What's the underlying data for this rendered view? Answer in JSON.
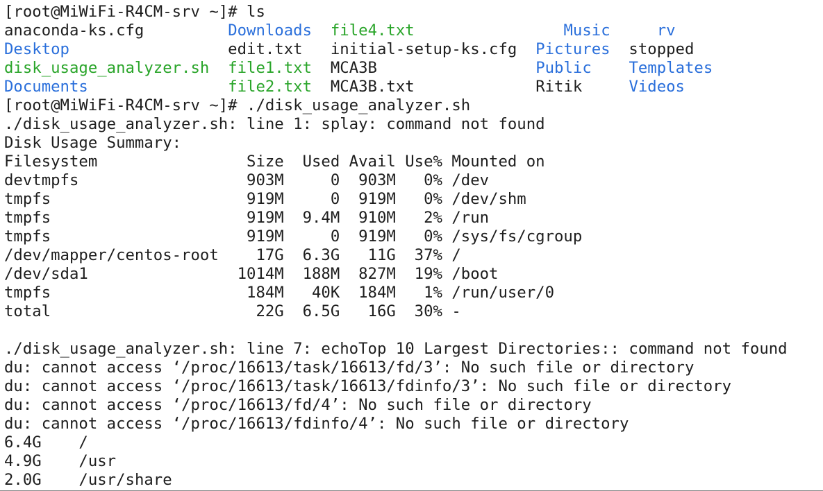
{
  "colors": {
    "directory": "#2a6fdb",
    "executable": "#2aa52a",
    "text": "#1e1e1e",
    "background": "#ffffff"
  },
  "lines": [
    [
      {
        "t": "[root@MiWiFi-R4CM-srv ~]# ls",
        "c": "plain"
      }
    ],
    [
      {
        "t": "anaconda-ks.cfg         ",
        "c": "plain"
      },
      {
        "t": "Downloads",
        "c": "dir"
      },
      {
        "t": "  ",
        "c": "plain"
      },
      {
        "t": "file4.txt",
        "c": "exe"
      },
      {
        "t": "                ",
        "c": "plain"
      },
      {
        "t": "Music",
        "c": "dir"
      },
      {
        "t": "     ",
        "c": "plain"
      },
      {
        "t": "rv",
        "c": "dir"
      }
    ],
    [
      {
        "t": "Desktop",
        "c": "dir"
      },
      {
        "t": "                 edit.txt   initial-setup-ks.cfg  ",
        "c": "plain"
      },
      {
        "t": "Pictures",
        "c": "dir"
      },
      {
        "t": "  stopped",
        "c": "plain"
      }
    ],
    [
      {
        "t": "disk_usage_analyzer.sh",
        "c": "exe"
      },
      {
        "t": "  ",
        "c": "plain"
      },
      {
        "t": "file1.txt",
        "c": "exe"
      },
      {
        "t": "  MCA3B                 ",
        "c": "plain"
      },
      {
        "t": "Public",
        "c": "dir"
      },
      {
        "t": "    ",
        "c": "plain"
      },
      {
        "t": "Templates",
        "c": "dir"
      }
    ],
    [
      {
        "t": "Documents",
        "c": "dir"
      },
      {
        "t": "               ",
        "c": "plain"
      },
      {
        "t": "file2.txt",
        "c": "exe"
      },
      {
        "t": "  MCA3B.txt             Ritik     ",
        "c": "plain"
      },
      {
        "t": "Videos",
        "c": "dir"
      }
    ],
    [
      {
        "t": "[root@MiWiFi-R4CM-srv ~]# ./disk_usage_analyzer.sh",
        "c": "plain"
      }
    ],
    [
      {
        "t": "./disk_usage_analyzer.sh: line 1: splay: command not found",
        "c": "plain"
      }
    ],
    [
      {
        "t": "Disk Usage Summary:",
        "c": "plain"
      }
    ],
    [
      {
        "t": "Filesystem                Size  Used Avail Use% Mounted on",
        "c": "plain"
      }
    ],
    [
      {
        "t": "devtmpfs                  903M     0  903M   0% /dev",
        "c": "plain"
      }
    ],
    [
      {
        "t": "tmpfs                     919M     0  919M   0% /dev/shm",
        "c": "plain"
      }
    ],
    [
      {
        "t": "tmpfs                     919M  9.4M  910M   2% /run",
        "c": "plain"
      }
    ],
    [
      {
        "t": "tmpfs                     919M     0  919M   0% /sys/fs/cgroup",
        "c": "plain"
      }
    ],
    [
      {
        "t": "/dev/mapper/centos-root    17G  6.3G   11G  37% /",
        "c": "plain"
      }
    ],
    [
      {
        "t": "/dev/sda1                1014M  188M  827M  19% /boot",
        "c": "plain"
      }
    ],
    [
      {
        "t": "tmpfs                     184M   40K  184M   1% /run/user/0",
        "c": "plain"
      }
    ],
    [
      {
        "t": "total                      22G  6.5G   16G  30% -",
        "c": "plain"
      }
    ],
    [
      {
        "t": "",
        "c": "plain"
      }
    ],
    [
      {
        "t": "./disk_usage_analyzer.sh: line 7: echoTop 10 Largest Directories:: command not found",
        "c": "plain"
      }
    ],
    [
      {
        "t": "du: cannot access ‘/proc/16613/task/16613/fd/3’: No such file or directory",
        "c": "plain"
      }
    ],
    [
      {
        "t": "du: cannot access ‘/proc/16613/task/16613/fdinfo/3’: No such file or directory",
        "c": "plain"
      }
    ],
    [
      {
        "t": "du: cannot access ‘/proc/16613/fd/4’: No such file or directory",
        "c": "plain"
      }
    ],
    [
      {
        "t": "du: cannot access ‘/proc/16613/fdinfo/4’: No such file or directory",
        "c": "plain"
      }
    ],
    [
      {
        "t": "6.4G\t/",
        "c": "plain"
      }
    ],
    [
      {
        "t": "4.9G\t/usr",
        "c": "plain"
      }
    ],
    [
      {
        "t": "2.0G\t/usr/share",
        "c": "plain"
      }
    ]
  ]
}
